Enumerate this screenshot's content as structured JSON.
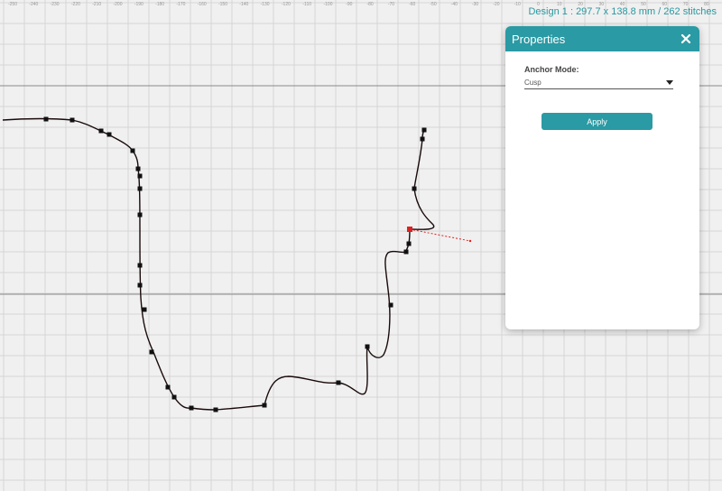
{
  "ruler": {
    "labels": [
      "-250",
      "-240",
      "-230",
      "-220",
      "-210",
      "-200",
      "-190",
      "-180",
      "-170",
      "-160",
      "-150",
      "-140",
      "-130",
      "-120",
      "-110",
      "-100",
      "-90",
      "-80",
      "-70",
      "-60",
      "-50",
      "-40",
      "-30",
      "-20",
      "-10",
      "0",
      "10",
      "20",
      "30",
      "40",
      "50",
      "60",
      "70",
      "80"
    ]
  },
  "status": {
    "design_info": "Design 1 : 297.7 x 138.8 mm / 262 stitches"
  },
  "panel": {
    "title": "Properties",
    "anchor_mode_label": "Anchor Mode:",
    "anchor_mode_value": "Cusp",
    "apply_label": "Apply"
  },
  "colors": {
    "accent": "#2a9aa4",
    "selected_node": "#e02020",
    "path": "#1a0a0a",
    "node": "#111111"
  },
  "icons": {
    "close": "close-icon",
    "dropdown": "caret-down-icon"
  }
}
